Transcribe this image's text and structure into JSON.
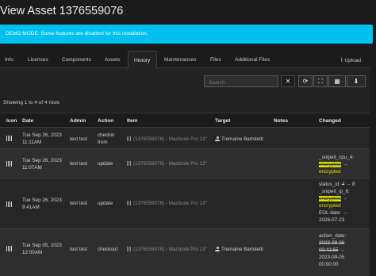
{
  "page": {
    "title": "View Asset 1376559076"
  },
  "alert": {
    "text": "DEMO MODE: Some features are disabled for this installation."
  },
  "tabs": [
    {
      "label": "Info"
    },
    {
      "label": "Licenses"
    },
    {
      "label": "Components"
    },
    {
      "label": "Assets"
    },
    {
      "label": "History"
    },
    {
      "label": "Maintenances"
    },
    {
      "label": "Files"
    },
    {
      "label": "Additional Files"
    },
    {
      "label": "Upload"
    }
  ],
  "toolbar": {
    "search_placeholder": "Search",
    "clear_icon": "✕",
    "refresh_icon": "⟳",
    "fullscreen_icon": "⛶",
    "columns_icon": "▦",
    "export_icon": "⬇"
  },
  "table": {
    "showing": "Showing 1 to 4 of 4 rows",
    "headers": [
      "Icon",
      "Date",
      "Admin",
      "Action",
      "Item",
      "Target",
      "Notes",
      "Changed"
    ],
    "rows": [
      {
        "date": [
          "Tue Sep 26, 2023",
          "11:11AM"
        ],
        "admin": "test test",
        "action": [
          "checkin",
          "from"
        ],
        "item": "(1376559076) - Macbook Pro 13\"",
        "target": "Tremaine Bartoletti",
        "changed": []
      },
      {
        "date": [
          "Tue Sep 26, 2023",
          "11:07AM"
        ],
        "admin": "test test",
        "action": [
          "update"
        ],
        "item": "(1376559076) - Macbook Pro 13\"",
        "target": "",
        "changed": [
          "_snipeit_cpu_4:",
          "encrypted",
          "→",
          "encrypted"
        ]
      },
      {
        "date": [
          "Tue Sep 26, 2023",
          "9:41AM"
        ],
        "admin": "test test",
        "action": [
          "update"
        ],
        "item": "(1376559076) - Macbook Pro 13\"",
        "target": "",
        "changed": [
          "status_id:",
          "4",
          "→",
          "8",
          "_snipeit_ip_6:",
          "encrypted",
          "→",
          "encrypted",
          "EOL date:",
          "→",
          "2026-07-23"
        ]
      },
      {
        "date": [
          "Tue Sep 05, 2023",
          "12:00AM"
        ],
        "admin": "test test",
        "action": [
          "checkout"
        ],
        "item": "(1376559076) - Macbook Pro 13\"",
        "target": "Tremaine Bartoletti",
        "changed": [
          "action_date:",
          "2023-09-26",
          "00:42:55",
          "→",
          "2023-09-05",
          "00:00:00"
        ]
      }
    ]
  }
}
